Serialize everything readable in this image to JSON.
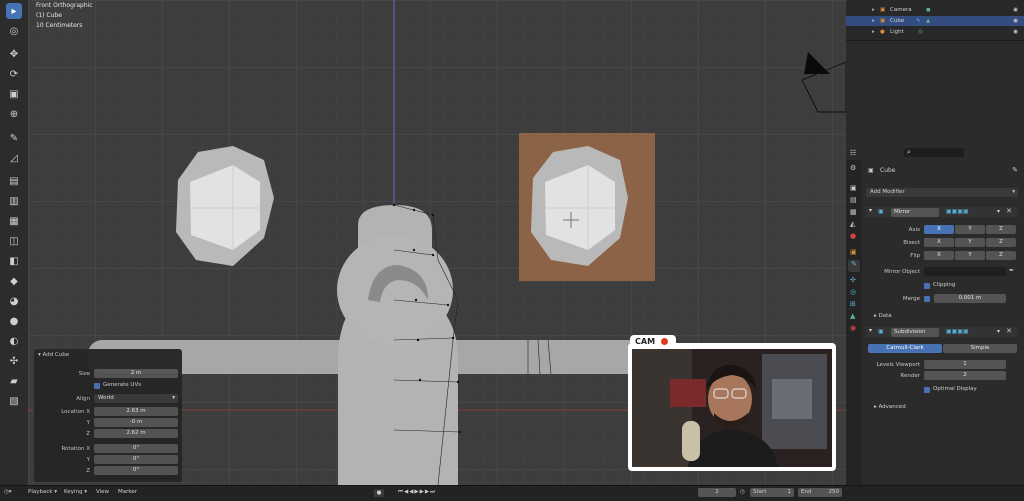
{
  "viewport": {
    "view_name": "Front Orthographic",
    "object_name": "(1) Cube",
    "scale": "10 Centimeters"
  },
  "outliner": {
    "items": [
      {
        "label": "Camera",
        "selected": false
      },
      {
        "label": "Cube",
        "selected": true
      },
      {
        "label": "Light",
        "selected": false
      }
    ]
  },
  "properties": {
    "object_name": "Cube",
    "add_modifier": "Add Modifier",
    "mirror": {
      "name": "Mirror",
      "axis_label": "Axis",
      "bisect_label": "Bisect",
      "flip_label": "Flip",
      "x": "X",
      "y": "Y",
      "z": "Z",
      "mirror_object_label": "Mirror Object",
      "clipping_label": "Clipping",
      "merge_label": "Merge",
      "merge_value": "0.001 m",
      "data_label": "Data"
    },
    "subdivision": {
      "name": "Subdivision",
      "catmull": "Catmull-Clark",
      "simple": "Simple",
      "levels_label": "Levels Viewport",
      "levels_value": "1",
      "render_label": "Render",
      "render_value": "2",
      "optimal_label": "Optimal Display",
      "advanced_label": "Advanced"
    }
  },
  "add_cube": {
    "title": "Add Cube",
    "size_label": "Size",
    "size_value": "2 m",
    "uvs_label": "Generate UVs",
    "align_label": "Align",
    "align_value": "World",
    "loc_x_label": "Location X",
    "loc_x_value": "2.63 m",
    "loc_y_label": "Y",
    "loc_y_value": "-0 m",
    "loc_z_label": "Z",
    "loc_z_value": "2.62 m",
    "rot_x_label": "Rotation X",
    "rot_x_value": "0°",
    "rot_y_label": "Y",
    "rot_y_value": "0°",
    "rot_z_label": "Z",
    "rot_z_value": "0°"
  },
  "cam": {
    "label": "CAM"
  },
  "timeline": {
    "playback": "Playback",
    "keying": "Keying",
    "view": "View",
    "marker": "Marker",
    "current_frame": "2",
    "start_label": "Start",
    "start_value": "1",
    "end_label": "End",
    "end_value": "250"
  }
}
